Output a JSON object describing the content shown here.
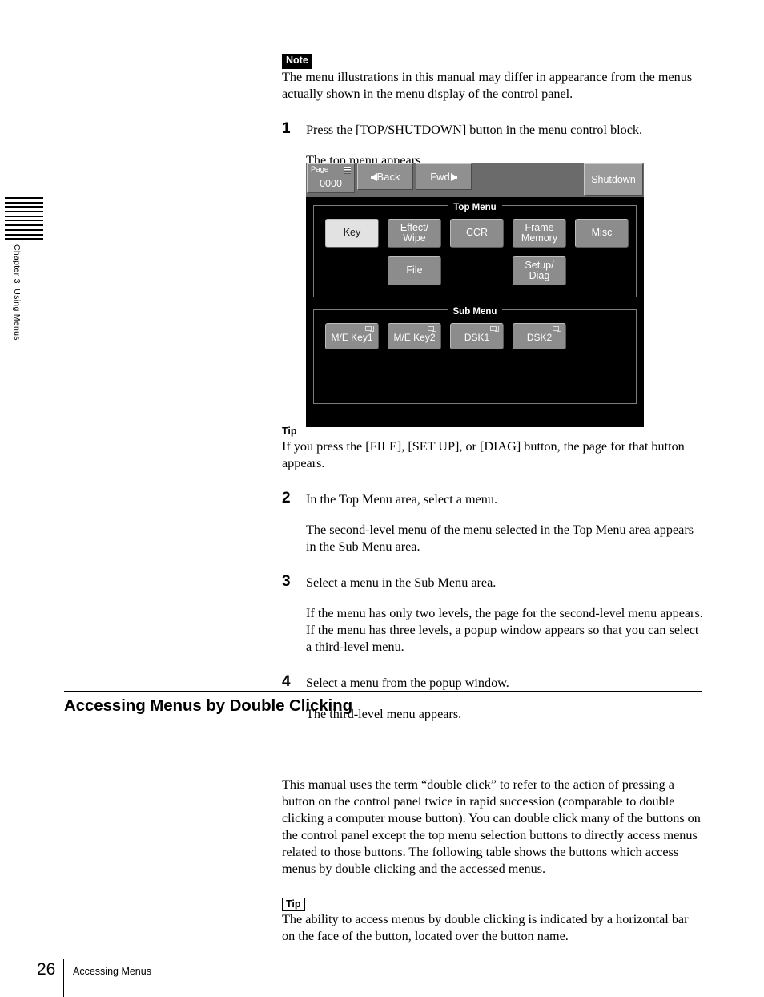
{
  "margin": {
    "chapter_label": "Chapter 3  Using Menus",
    "tab_line_count": 10
  },
  "note": {
    "tag": "Note",
    "text": "The menu illustrations in this manual may differ in appearance from the menus actually shown in the menu display of the control panel."
  },
  "steps": [
    {
      "number": "1",
      "instruction": "Press the [TOP/SHUTDOWN] button in the menu control block.",
      "result": "The top menu appears."
    },
    {
      "number": "2",
      "instruction": "In the Top Menu area, select a menu.",
      "result": "The second-level menu of the menu selected in the Top Menu area appears in the Sub Menu area."
    },
    {
      "number": "3",
      "instruction": "Select a menu in the Sub Menu area.",
      "result": "If the menu has only two levels, the page for the second-level menu appears. If the menu has three levels, a popup window appears so that you can select a third-level menu."
    },
    {
      "number": "4",
      "instruction": "Select a menu from the popup window.",
      "result": "The third-level menu appears."
    }
  ],
  "tip_after_figure": {
    "tag": "Tip",
    "text": "If you press the [FILE], [SET UP], or [DIAG] button, the page for that button appears."
  },
  "menu_figure": {
    "header": {
      "page_label": "Page",
      "page_value": "0000",
      "back_label": "Back",
      "fwd_label": "Fwd",
      "shutdown_label": "Shutdown"
    },
    "top_menu": {
      "title": "Top Menu",
      "row1": [
        {
          "label": "Key",
          "selected": true
        },
        {
          "label": "Effect/\nWipe",
          "selected": false
        },
        {
          "label": "CCR",
          "selected": false
        },
        {
          "label": "Frame\nMemory",
          "selected": false
        },
        {
          "label": "Misc",
          "selected": false
        }
      ],
      "row2": [
        {
          "label": "File",
          "selected": false,
          "column": 2
        },
        {
          "label": "Setup/\nDiag",
          "selected": false,
          "column": 4
        }
      ]
    },
    "sub_menu": {
      "title": "Sub Menu",
      "buttons": [
        {
          "label": "M/E Key1",
          "double_click_icon": true
        },
        {
          "label": "M/E Key2",
          "double_click_icon": true
        },
        {
          "label": "DSK1",
          "double_click_icon": true
        },
        {
          "label": "DSK2",
          "double_click_icon": true
        }
      ]
    },
    "colors": {
      "screen_background": "#000000",
      "header_bar": "#6b6b6b",
      "button_face": "#8c8c8c",
      "button_selected": "#e2e2e2",
      "border": "#7d7d7d",
      "text": "#ffffff"
    }
  },
  "section": {
    "heading": "Accessing Menus by Double Clicking",
    "body": "This manual uses the term “double click” to refer to the action of pressing a button on the control panel twice in rapid succession (comparable to double clicking a computer mouse button). You can double click many of the buttons on the control panel except the top menu selection buttons to directly access menus related to those buttons. The following table shows the buttons which access menus by double clicking and the accessed menus.",
    "tip": {
      "tag": "Tip",
      "text": "The ability to access menus by double clicking is indicated by a horizontal bar on the face of the button, located over the button name."
    }
  },
  "footer": {
    "page_number": "26",
    "section_name": "Accessing Menus"
  }
}
